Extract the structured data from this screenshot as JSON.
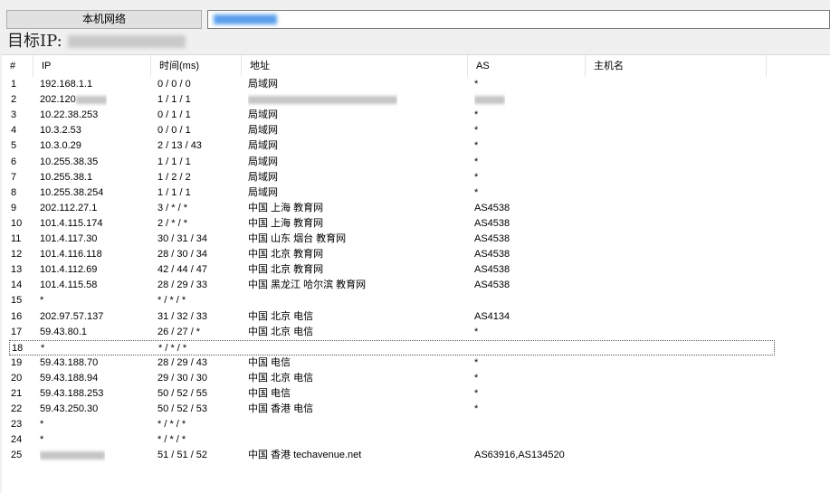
{
  "toolbar": {
    "local_network_button": "本机网络"
  },
  "target_label": "目标IP:",
  "columns": [
    "#",
    "IP",
    "时间(ms)",
    "地址",
    "AS",
    "主机名"
  ],
  "rows": [
    {
      "n": "1",
      "ip": "192.168.1.1",
      "time": "0 / 0 / 0",
      "addr": "局域网",
      "as": "*"
    },
    {
      "n": "2",
      "ip": "202.120",
      "time": "1 / 1 / 1",
      "addr": "",
      "as": ""
    },
    {
      "n": "3",
      "ip": "10.22.38.253",
      "time": "0 / 1 / 1",
      "addr": "局域网",
      "as": "*"
    },
    {
      "n": "4",
      "ip": "10.3.2.53",
      "time": "0 / 0 / 1",
      "addr": "局域网",
      "as": "*"
    },
    {
      "n": "5",
      "ip": "10.3.0.29",
      "time": "2 / 13 / 43",
      "addr": "局域网",
      "as": "*"
    },
    {
      "n": "6",
      "ip": "10.255.38.35",
      "time": "1 / 1 / 1",
      "addr": "局域网",
      "as": "*"
    },
    {
      "n": "7",
      "ip": "10.255.38.1",
      "time": "1 / 2 / 2",
      "addr": "局域网",
      "as": "*"
    },
    {
      "n": "8",
      "ip": "10.255.38.254",
      "time": "1 / 1 / 1",
      "addr": "局域网",
      "as": "*"
    },
    {
      "n": "9",
      "ip": "202.112.27.1",
      "time": "3 / * / *",
      "addr": "中国 上海 教育网",
      "as": "AS4538"
    },
    {
      "n": "10",
      "ip": "101.4.115.174",
      "time": "2 / * / *",
      "addr": "中国 上海 教育网",
      "as": "AS4538"
    },
    {
      "n": "11",
      "ip": "101.4.117.30",
      "time": "30 / 31 / 34",
      "addr": "中国 山东 烟台 教育网",
      "as": "AS4538"
    },
    {
      "n": "12",
      "ip": "101.4.116.118",
      "time": "28 / 30 / 34",
      "addr": "中国 北京 教育网",
      "as": "AS4538"
    },
    {
      "n": "13",
      "ip": "101.4.112.69",
      "time": "42 / 44 / 47",
      "addr": "中国 北京 教育网",
      "as": "AS4538"
    },
    {
      "n": "14",
      "ip": "101.4.115.58",
      "time": "28 / 29 / 33",
      "addr": "中国 黑龙江 哈尔滨 教育网",
      "as": "AS4538"
    },
    {
      "n": "15",
      "ip": "*",
      "time": "* / * / *",
      "addr": "",
      "as": ""
    },
    {
      "n": "16",
      "ip": "202.97.57.137",
      "time": "31 / 32 / 33",
      "addr": "中国 北京 电信",
      "as": "AS4134"
    },
    {
      "n": "17",
      "ip": "59.43.80.1",
      "time": "26 / 27 / *",
      "addr": "中国 北京 电信",
      "as": "*"
    },
    {
      "n": "18",
      "ip": "*",
      "time": "* / * / *",
      "addr": "",
      "as": ""
    },
    {
      "n": "19",
      "ip": "59.43.188.70",
      "time": "28 / 29 / 43",
      "addr": "中国 电信",
      "as": "*"
    },
    {
      "n": "20",
      "ip": "59.43.188.94",
      "time": "29 / 30 / 30",
      "addr": "中国 北京 电信",
      "as": "*"
    },
    {
      "n": "21",
      "ip": "59.43.188.253",
      "time": "50 / 52 / 55",
      "addr": "中国 电信",
      "as": "*"
    },
    {
      "n": "22",
      "ip": "59.43.250.30",
      "time": "50 / 52 / 53",
      "addr": "中国 香港 电信",
      "as": "*"
    },
    {
      "n": "23",
      "ip": "*",
      "time": "* / * / *",
      "addr": "",
      "as": ""
    },
    {
      "n": "24",
      "ip": "*",
      "time": "* / * / *",
      "addr": "",
      "as": ""
    },
    {
      "n": "25",
      "ip": "",
      "time": "51 / 51 / 52",
      "addr": "中国 香港 techavenue.net",
      "as": "AS63916,AS134520"
    }
  ]
}
